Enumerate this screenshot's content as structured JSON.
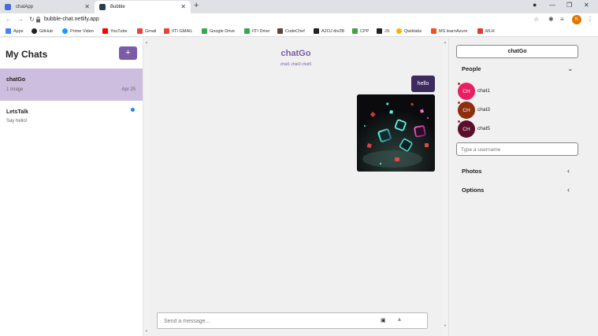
{
  "browser": {
    "tabs": [
      {
        "title": "chatApp",
        "icon": "chatapp-favicon",
        "color": "#4a6cd4"
      },
      {
        "title": "Bubble",
        "icon": "bubble-favicon",
        "color": "#2e3b4e"
      }
    ],
    "new_tab": "+",
    "url": "bubble-chat.netlify.app",
    "profile_initial": "K",
    "bookmarks": [
      {
        "label": "Apps",
        "color": "#4285f4"
      },
      {
        "label": "GitHub",
        "color": "#222222"
      },
      {
        "label": "Prime Video",
        "color": "#1a98ff"
      },
      {
        "label": "YouTube",
        "color": "#ff0000"
      },
      {
        "label": "Gmail",
        "color": "#ea4335"
      },
      {
        "label": "IITI GMAIL",
        "color": "#ea4335"
      },
      {
        "label": "Google Drive",
        "color": "#34a853"
      },
      {
        "label": "IITI Drive",
        "color": "#34a853"
      },
      {
        "label": "CodeChef",
        "color": "#5b4638"
      },
      {
        "label": "A2OJ div2B",
        "color": "#222222"
      },
      {
        "label": "CPP",
        "color": "#43a047"
      },
      {
        "label": "JS",
        "color": "#222222"
      },
      {
        "label": "Qwiklabs",
        "color": "#f4b400"
      },
      {
        "label": "MS learnAzure",
        "color": "#f25022"
      },
      {
        "label": "MLH",
        "color": "#e53935"
      }
    ]
  },
  "sidebar": {
    "title": "My Chats",
    "add_label": "+",
    "chats": [
      {
        "name": "chatGo",
        "subtitle": "1 image",
        "date": "Apr 25",
        "selected": true
      },
      {
        "name": "LetsTalk",
        "subtitle": "Say hello!",
        "unread": true
      }
    ]
  },
  "conversation": {
    "title": "chatGo",
    "members": "chat1 chat3 chat5",
    "messages": [
      {
        "type": "text",
        "text": "hello"
      },
      {
        "type": "image",
        "description": "neon cubes"
      }
    ],
    "composer_placeholder": "Send a message..."
  },
  "right_panel": {
    "title": "chatGo",
    "people_label": "People",
    "people": [
      {
        "initials": "CH",
        "name": "chat1",
        "color": "#e91e63"
      },
      {
        "initials": "CH",
        "name": "chat3",
        "color": "#8d2e0c"
      },
      {
        "initials": "CH",
        "name": "chat5",
        "color": "#5a0f2a"
      }
    ],
    "username_placeholder": "Type a username",
    "photos_label": "Photos",
    "options_label": "Options"
  },
  "colors": {
    "accent": "#7b5ca8",
    "selected_chat": "#cdbddf",
    "message_bubble": "#3d2a5e",
    "unread_dot": "#1e88e5"
  }
}
